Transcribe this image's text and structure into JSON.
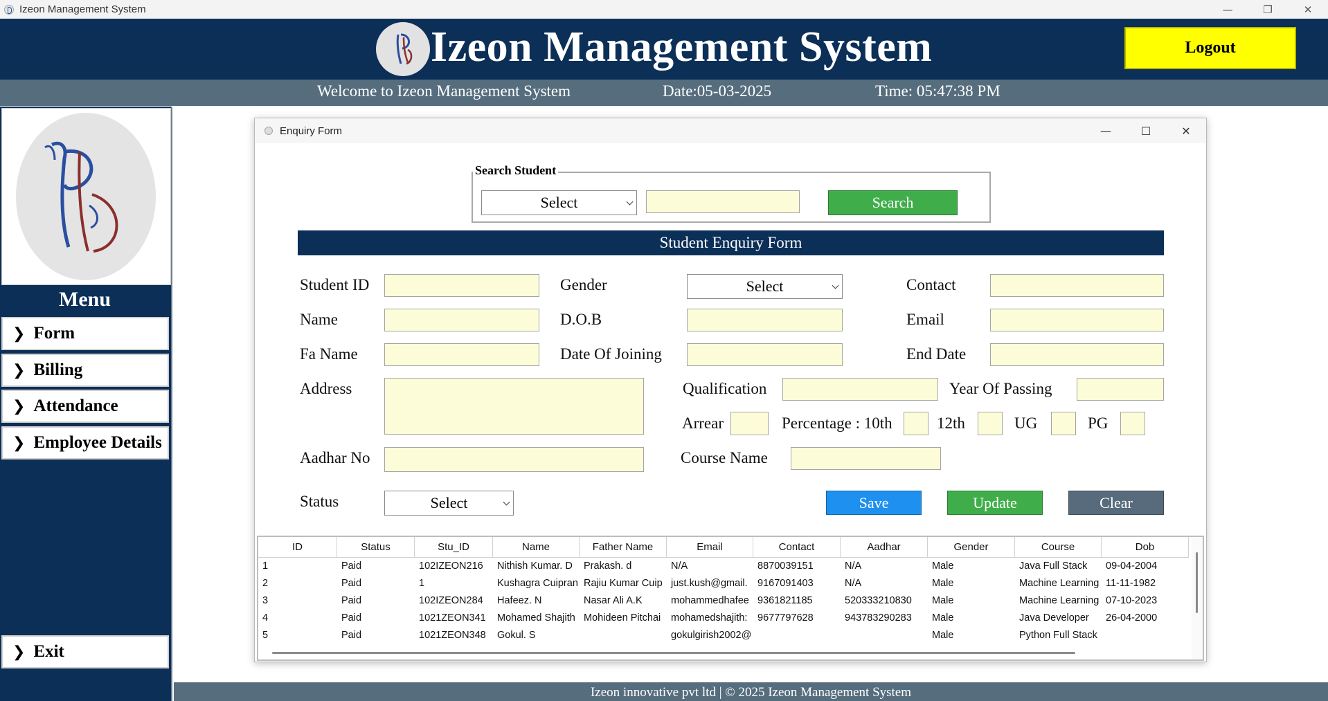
{
  "window": {
    "title": "Izeon Management System",
    "controls": {
      "minimize": "—",
      "restore": "❐",
      "close": "✕"
    }
  },
  "header": {
    "title": "Izeon Management System",
    "logout_label": "Logout"
  },
  "infobar": {
    "welcome": "Welcome to Izeon Management System",
    "date": "Date:05-03-2025",
    "time": "Time: 05:47:38 PM"
  },
  "sidebar": {
    "menu_title": "Menu",
    "items": [
      {
        "label": "Form"
      },
      {
        "label": "Billing"
      },
      {
        "label": "Attendance"
      },
      {
        "label": "Employee Details"
      }
    ],
    "exit_label": "Exit"
  },
  "dialog": {
    "title": "Enquiry Form",
    "search": {
      "legend": "Search Student",
      "select_value": "Select",
      "input_value": "",
      "button_label": "Search"
    },
    "form_title": "Student Enquiry Form",
    "labels": {
      "student_id": "Student ID",
      "name": "Name",
      "fa_name": "Fa Name",
      "address": "Address",
      "aadhar": "Aadhar No",
      "status": "Status",
      "gender": "Gender",
      "dob": "D.O.B",
      "doj": "Date Of Joining",
      "contact": "Contact",
      "email": "Email",
      "end_date": "End Date",
      "qualification": "Qualification",
      "year_of_passing": "Year Of Passing",
      "arrear": "Arrear",
      "percentage_10th": "Percentage : 10th",
      "p12th": "12th",
      "ug": "UG",
      "pg": "PG",
      "course_name": "Course Name"
    },
    "selects": {
      "gender": "Select",
      "status": "Select"
    },
    "buttons": {
      "save": "Save",
      "update": "Update",
      "clear": "Clear"
    },
    "table": {
      "columns": [
        "ID",
        "Status",
        "Stu_ID",
        "Name",
        "Father Name",
        "Email",
        "Contact",
        "Aadhar",
        "Gender",
        "Course",
        "Dob"
      ],
      "rows": [
        [
          "1",
          "Paid",
          "102IZEON216",
          "Nithish Kumar. D",
          "Prakash. d",
          "N/A",
          "8870039151",
          "N/A",
          "Male",
          "Java Full Stack",
          "09-04-2004"
        ],
        [
          "2",
          "Paid",
          "1",
          "Kushagra Cuipran",
          "Rajiu Kumar Cuip",
          "just.kush@gmail.",
          "9167091403",
          "N/A",
          "Male",
          "Machine Learning",
          "11-11-1982"
        ],
        [
          "3",
          "Paid",
          "102IZEON284",
          "Hafeez. N",
          "Nasar Ali A.K",
          "mohammedhafee",
          "9361821185",
          "520333210830",
          "Male",
          "Machine Learning",
          "07-10-2023"
        ],
        [
          "4",
          "Paid",
          "1021ZEON341",
          "Mohamed Shajith",
          "Mohideen Pitchai",
          "mohamedshajith:",
          "9677797628",
          "943783290283",
          "Male",
          "Java Developer",
          "26-04-2000"
        ],
        [
          "5",
          "Paid",
          "1021ZEON348",
          "Gokul. S",
          "",
          "gokulgirish2002@",
          "",
          "",
          "Male",
          "Python Full Stack",
          ""
        ]
      ]
    }
  },
  "footer": {
    "text": "Izeon innovative pvt ltd | © 2025 Izeon Management System"
  },
  "colors": {
    "navy": "#0b2f57",
    "slate": "#566d7e",
    "input_bg": "#fdfcd8",
    "logout_yellow": "#ffff00",
    "green": "#3fae4a",
    "blue": "#1e90f0"
  }
}
